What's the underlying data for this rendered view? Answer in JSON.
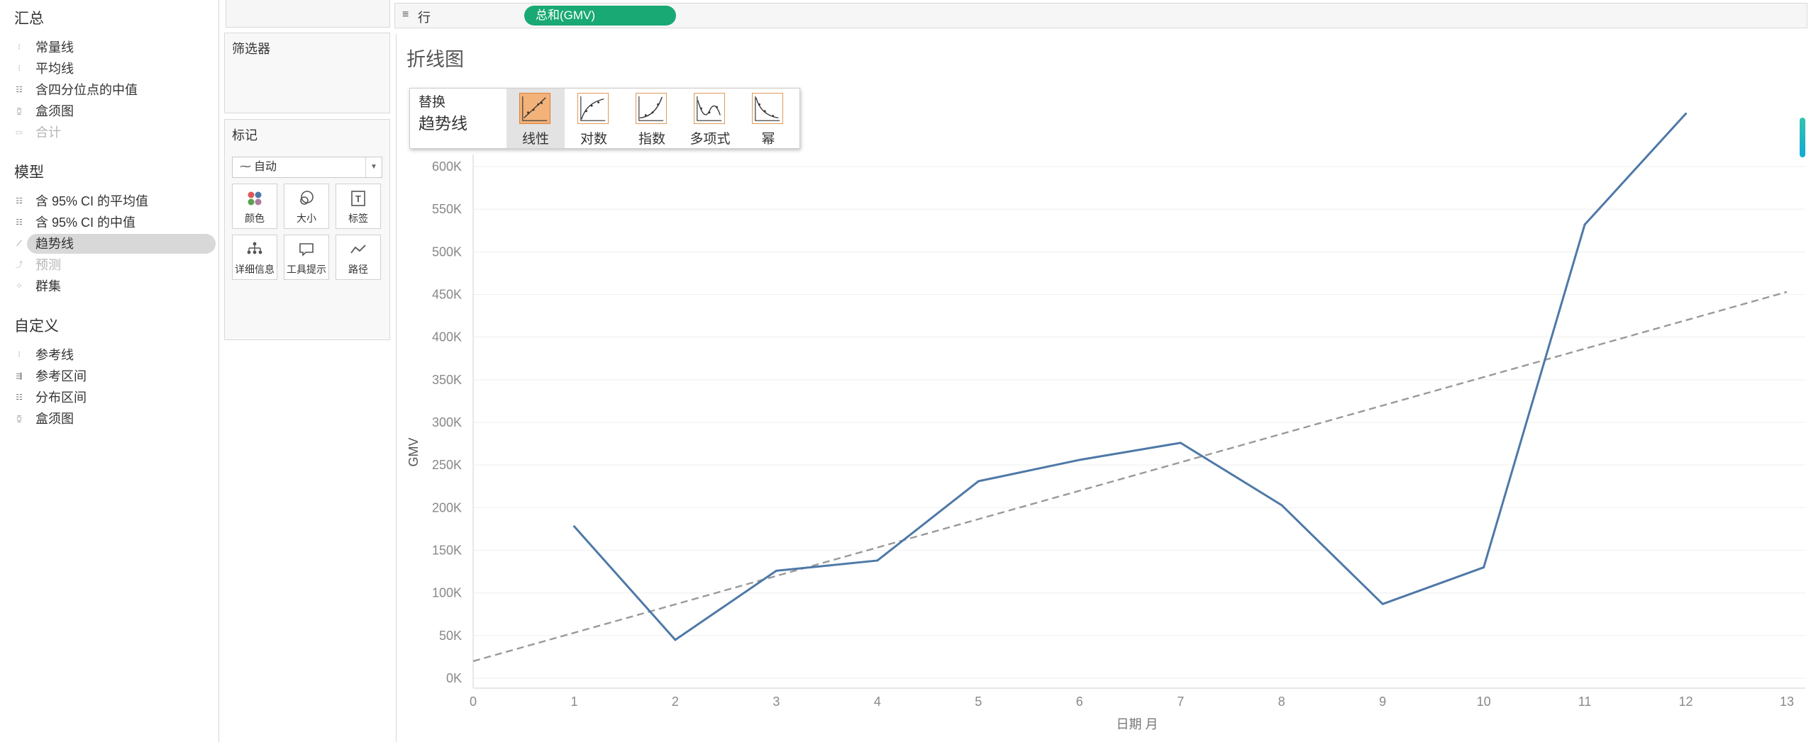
{
  "analytics": {
    "summary": {
      "title": "汇总",
      "items": [
        {
          "label": "常量线",
          "icon": "reference-line-icon",
          "enabled": true
        },
        {
          "label": "平均线",
          "icon": "reference-line-icon",
          "enabled": true
        },
        {
          "label": "含四分位点的中值",
          "icon": "distribution-band-icon",
          "enabled": true
        },
        {
          "label": "盒须图",
          "icon": "box-plot-icon",
          "enabled": true
        },
        {
          "label": "合计",
          "icon": "totals-icon",
          "enabled": false
        }
      ]
    },
    "model": {
      "title": "模型",
      "items": [
        {
          "label": "含 95% CI 的平均值",
          "icon": "distribution-band-icon",
          "enabled": true
        },
        {
          "label": "含 95% CI 的中值",
          "icon": "distribution-band-icon",
          "enabled": true
        },
        {
          "label": "趋势线",
          "icon": "trend-line-icon",
          "enabled": true,
          "selected": true
        },
        {
          "label": "预测",
          "icon": "forecast-icon",
          "enabled": false
        },
        {
          "label": "群集",
          "icon": "cluster-icon",
          "enabled": true
        }
      ]
    },
    "custom": {
      "title": "自定义",
      "items": [
        {
          "label": "参考线",
          "icon": "reference-line-icon",
          "enabled": true
        },
        {
          "label": "参考区间",
          "icon": "reference-band-icon",
          "enabled": true
        },
        {
          "label": "分布区间",
          "icon": "distribution-band-icon",
          "enabled": true
        },
        {
          "label": "盒须图",
          "icon": "box-plot-icon",
          "enabled": true
        }
      ]
    }
  },
  "filters": {
    "title": "筛选器"
  },
  "marks": {
    "title": "标记",
    "dropdown_value": "自动",
    "cards": [
      {
        "label": "颜色",
        "icon": "color-icon"
      },
      {
        "label": "大小",
        "icon": "size-icon"
      },
      {
        "label": "标签",
        "icon": "label-icon"
      },
      {
        "label": "详细信息",
        "icon": "detail-icon"
      },
      {
        "label": "工具提示",
        "icon": "tooltip-icon"
      },
      {
        "label": "路径",
        "icon": "path-icon"
      }
    ]
  },
  "shelf": {
    "rows_label": "行",
    "pill": "总和(GMV)",
    "pill_color": "#19a974"
  },
  "sheet": {
    "title": "折线图"
  },
  "trend_popup": {
    "line1": "替换",
    "line2": "趋势线",
    "options": [
      {
        "label": "线性",
        "icon": "linear-trend-icon",
        "selected": true
      },
      {
        "label": "对数",
        "icon": "log-trend-icon",
        "selected": false
      },
      {
        "label": "指数",
        "icon": "exp-trend-icon",
        "selected": false
      },
      {
        "label": "多项式",
        "icon": "poly-trend-icon",
        "selected": false
      },
      {
        "label": "幂",
        "icon": "power-trend-icon",
        "selected": false
      }
    ]
  },
  "chart_data": {
    "type": "line",
    "title": "折线图",
    "xlabel": "日期 月",
    "ylabel": "GMV",
    "x": [
      1,
      2,
      3,
      4,
      5,
      6,
      7,
      8,
      9,
      10,
      11,
      12
    ],
    "series": [
      {
        "name": "总和(GMV)",
        "values": [
          178000,
          45000,
          126000,
          138000,
          231000,
          256000,
          276000,
          203000,
          87000,
          130000,
          532000,
          662000
        ],
        "color": "#4e79a7"
      }
    ],
    "trend_line": {
      "type": "linear",
      "start": [
        0,
        20000
      ],
      "end": [
        13,
        453000
      ],
      "color": "#999999",
      "style": "dashed"
    },
    "xlim": [
      0,
      13
    ],
    "ylim": [
      0,
      600000
    ],
    "x_ticks": [
      "0",
      "1",
      "2",
      "3",
      "4",
      "5",
      "6",
      "7",
      "8",
      "9",
      "10",
      "11",
      "12",
      "13"
    ],
    "y_ticks": [
      "0K",
      "50K",
      "100K",
      "150K",
      "200K",
      "250K",
      "300K",
      "350K",
      "400K",
      "450K",
      "500K",
      "550K",
      "600K"
    ],
    "grid": true
  }
}
